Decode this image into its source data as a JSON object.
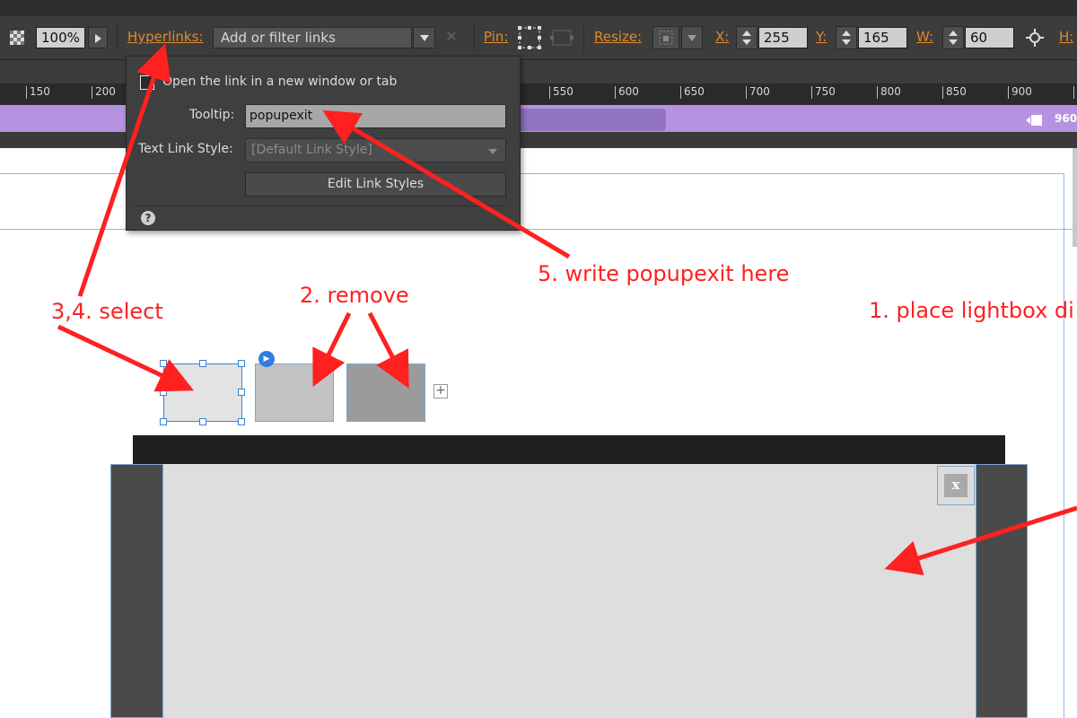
{
  "toolbar": {
    "zoom_value": "100%",
    "hyperlinks_label": "Hyperlinks:",
    "link_filter_placeholder": "Add or filter links",
    "pin_label": "Pin:",
    "resize_label": "Resize:",
    "x_label": "X:",
    "x_value": "255",
    "y_label": "Y:",
    "y_value": "165",
    "w_label": "W:",
    "w_value": "60",
    "h_label": "H:"
  },
  "ruler": {
    "ticks": [
      "150",
      "200",
      "550",
      "600",
      "650",
      "700",
      "750",
      "800",
      "850",
      "900"
    ],
    "page_width_label": "960"
  },
  "popup": {
    "open_new_window_label": "Open the link in a new window or tab",
    "tooltip_label": "Tooltip:",
    "tooltip_value": "popupexit",
    "text_link_style_label": "Text Link Style:",
    "text_link_style_value": "[Default Link Style]",
    "edit_link_styles_label": "Edit Link Styles",
    "help_icon_glyph": "?"
  },
  "canvas": {
    "close_glyph": "x",
    "add_glyph": "+",
    "play_glyph": "▶"
  },
  "annotations": {
    "step1": "1. place lightbox di",
    "step2": "2. remove",
    "step34": "3,4. select",
    "step5": "5. write popupexit here"
  },
  "colors": {
    "accent_orange": "#e08a2c",
    "annotation_red": "#ff2020",
    "selection_blue": "#3a82d6",
    "purple_bar": "#b693e0"
  }
}
